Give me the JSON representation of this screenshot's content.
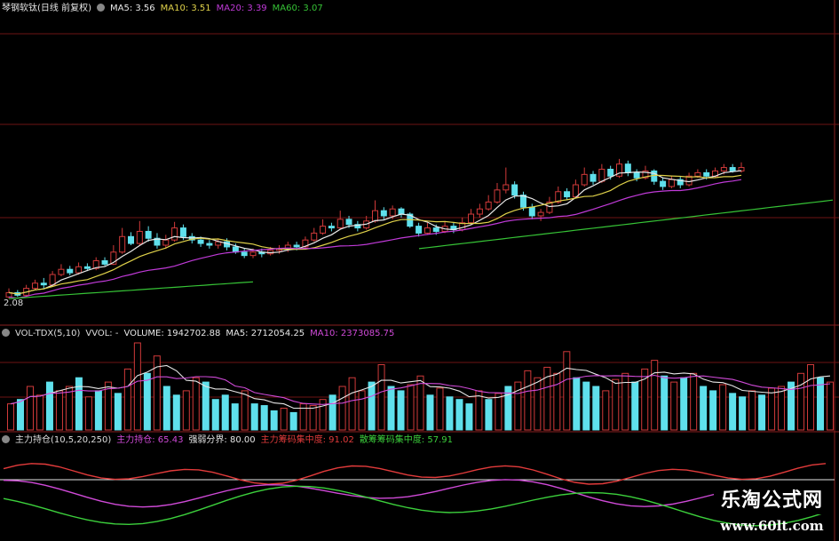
{
  "colors": {
    "background": "#000000",
    "frame": "#8a1f1f",
    "grid": "#6e1414",
    "up": "#d13a3a",
    "down": "#5fe0ec",
    "ma5": "#e8e8e8",
    "ma10": "#e0d24a",
    "ma20": "#c03ad8",
    "ma60": "#36c336",
    "main_force": "#e23b3b",
    "retail": "#3cd03c",
    "purple": "#d04ad8",
    "white_line": "#e6e6e6"
  },
  "main_panel": {
    "title": "琴钢软钛(日线 前复权)",
    "ma5_label": "MA5: 3.56",
    "ma10_label": "MA10: 3.51",
    "ma20_label": "MA20: 3.39",
    "ma60_label": "MA60: 3.07",
    "low_label": "2.08"
  },
  "volume_panel": {
    "name": "VOL-TDX(5,10)",
    "vvol": "VVOL: -",
    "volume": "VOLUME: 1942702.88",
    "ma5": "MA5: 2712054.25",
    "ma10": "MA10: 2373085.75"
  },
  "indicator_panel": {
    "name": "主力持仓(10,5,20,250)",
    "main": "主力持仓: 65.43",
    "strong": "强弱分界: 80.00",
    "main_chip": "主力筹码集中度: 91.02",
    "retail_chip": "散筹筹码集中度: 57.91"
  },
  "watermark": {
    "line1": "乐淘公式网",
    "line2": "www.60lt.com"
  },
  "chart_data": [
    {
      "type": "candlestick",
      "title": "琴钢软钛(日线 前复权)",
      "ylim": [
        2.0,
        4.1
      ],
      "low_marker": 2.08,
      "moving_averages": {
        "MA5": 3.56,
        "MA10": 3.51,
        "MA20": 3.39,
        "MA60": 3.07
      },
      "candles": [
        [
          2.1,
          2.15,
          2.2,
          2.08
        ],
        [
          2.15,
          2.12,
          2.18,
          2.1
        ],
        [
          2.12,
          2.2,
          2.24,
          2.1
        ],
        [
          2.2,
          2.26,
          2.3,
          2.18
        ],
        [
          2.26,
          2.24,
          2.32,
          2.2
        ],
        [
          2.24,
          2.36,
          2.4,
          2.22
        ],
        [
          2.36,
          2.42,
          2.48,
          2.34
        ],
        [
          2.42,
          2.38,
          2.46,
          2.35
        ],
        [
          2.38,
          2.45,
          2.5,
          2.36
        ],
        [
          2.45,
          2.43,
          2.49,
          2.4
        ],
        [
          2.43,
          2.52,
          2.56,
          2.41
        ],
        [
          2.52,
          2.48,
          2.56,
          2.46
        ],
        [
          2.48,
          2.62,
          2.7,
          2.47
        ],
        [
          2.62,
          2.8,
          2.9,
          2.6
        ],
        [
          2.8,
          2.72,
          2.85,
          2.7
        ],
        [
          2.72,
          2.86,
          2.98,
          2.7
        ],
        [
          2.86,
          2.78,
          2.92,
          2.74
        ],
        [
          2.78,
          2.7,
          2.84,
          2.66
        ],
        [
          2.7,
          2.76,
          2.82,
          2.66
        ],
        [
          2.76,
          2.9,
          2.97,
          2.74
        ],
        [
          2.9,
          2.8,
          2.94,
          2.76
        ],
        [
          2.8,
          2.76,
          2.84,
          2.72
        ],
        [
          2.76,
          2.72,
          2.8,
          2.68
        ],
        [
          2.72,
          2.7,
          2.76,
          2.66
        ],
        [
          2.7,
          2.74,
          2.78,
          2.66
        ],
        [
          2.74,
          2.68,
          2.78,
          2.64
        ],
        [
          2.68,
          2.62,
          2.72,
          2.6
        ],
        [
          2.62,
          2.58,
          2.66,
          2.55
        ],
        [
          2.58,
          2.62,
          2.66,
          2.55
        ],
        [
          2.62,
          2.6,
          2.66,
          2.56
        ],
        [
          2.6,
          2.64,
          2.68,
          2.58
        ],
        [
          2.64,
          2.66,
          2.7,
          2.6
        ],
        [
          2.66,
          2.7,
          2.74,
          2.62
        ],
        [
          2.7,
          2.68,
          2.74,
          2.64
        ],
        [
          2.68,
          2.76,
          2.8,
          2.66
        ],
        [
          2.76,
          2.84,
          2.9,
          2.74
        ],
        [
          2.84,
          2.92,
          3.0,
          2.82
        ],
        [
          2.92,
          2.9,
          2.96,
          2.86
        ],
        [
          2.9,
          3.0,
          3.1,
          2.88
        ],
        [
          3.0,
          2.94,
          3.04,
          2.9
        ],
        [
          2.94,
          2.9,
          2.98,
          2.86
        ],
        [
          2.9,
          2.98,
          3.04,
          2.88
        ],
        [
          2.98,
          3.1,
          3.22,
          2.96
        ],
        [
          3.1,
          3.04,
          3.14,
          3.0
        ],
        [
          3.04,
          3.12,
          3.16,
          3.0
        ],
        [
          3.12,
          3.06,
          3.14,
          3.02
        ],
        [
          3.06,
          2.92,
          3.08,
          2.9
        ],
        [
          2.92,
          2.84,
          2.96,
          2.8
        ],
        [
          2.84,
          2.9,
          2.96,
          2.82
        ],
        [
          2.9,
          2.86,
          2.94,
          2.82
        ],
        [
          2.86,
          2.92,
          2.98,
          2.84
        ],
        [
          2.92,
          2.88,
          2.96,
          2.84
        ],
        [
          2.88,
          2.96,
          3.02,
          2.86
        ],
        [
          2.96,
          3.06,
          3.12,
          2.94
        ],
        [
          3.06,
          3.12,
          3.18,
          3.02
        ],
        [
          3.12,
          3.2,
          3.28,
          3.1
        ],
        [
          3.2,
          3.34,
          3.42,
          3.18
        ],
        [
          3.34,
          3.4,
          3.6,
          3.3
        ],
        [
          3.4,
          3.28,
          3.44,
          3.24
        ],
        [
          3.28,
          3.14,
          3.32,
          3.1
        ],
        [
          3.14,
          3.04,
          3.18,
          3.0
        ],
        [
          3.04,
          3.08,
          3.12,
          2.98
        ],
        [
          3.08,
          3.2,
          3.26,
          3.06
        ],
        [
          3.2,
          3.32,
          3.38,
          3.18
        ],
        [
          3.32,
          3.26,
          3.36,
          3.22
        ],
        [
          3.26,
          3.4,
          3.46,
          3.24
        ],
        [
          3.4,
          3.52,
          3.6,
          3.38
        ],
        [
          3.52,
          3.44,
          3.56,
          3.4
        ],
        [
          3.44,
          3.58,
          3.64,
          3.42
        ],
        [
          3.58,
          3.5,
          3.62,
          3.46
        ],
        [
          3.5,
          3.64,
          3.7,
          3.48
        ],
        [
          3.64,
          3.54,
          3.68,
          3.5
        ],
        [
          3.54,
          3.48,
          3.58,
          3.44
        ],
        [
          3.48,
          3.56,
          3.62,
          3.46
        ],
        [
          3.56,
          3.44,
          3.58,
          3.4
        ],
        [
          3.44,
          3.38,
          3.48,
          3.34
        ],
        [
          3.38,
          3.46,
          3.5,
          3.36
        ],
        [
          3.46,
          3.4,
          3.5,
          3.36
        ],
        [
          3.4,
          3.5,
          3.54,
          3.38
        ],
        [
          3.5,
          3.54,
          3.58,
          3.48
        ],
        [
          3.54,
          3.5,
          3.58,
          3.46
        ],
        [
          3.5,
          3.56,
          3.6,
          3.48
        ],
        [
          3.56,
          3.6,
          3.64,
          3.52
        ],
        [
          3.6,
          3.56,
          3.64,
          3.54
        ],
        [
          3.56,
          3.6,
          3.66,
          3.54
        ]
      ]
    },
    {
      "type": "bar",
      "title": "VOL-TDX(5,10)",
      "volume": 1942702.88,
      "ma5": 2712054.25,
      "ma10": 2373085.75,
      "values_relative": [
        0.3,
        0.35,
        0.5,
        0.4,
        0.55,
        0.45,
        0.5,
        0.6,
        0.38,
        0.45,
        0.55,
        0.42,
        0.7,
        1.0,
        0.65,
        0.85,
        0.5,
        0.4,
        0.45,
        0.6,
        0.55,
        0.35,
        0.4,
        0.3,
        0.45,
        0.3,
        0.28,
        0.22,
        0.25,
        0.2,
        0.3,
        0.28,
        0.35,
        0.4,
        0.5,
        0.6,
        0.45,
        0.55,
        0.75,
        0.5,
        0.45,
        0.52,
        0.62,
        0.4,
        0.48,
        0.38,
        0.35,
        0.3,
        0.45,
        0.35,
        0.42,
        0.5,
        0.55,
        0.68,
        0.6,
        0.72,
        0.65,
        0.9,
        0.6,
        0.55,
        0.5,
        0.45,
        0.58,
        0.65,
        0.55,
        0.7,
        0.8,
        0.62,
        0.55,
        0.6,
        0.65,
        0.5,
        0.45,
        0.52,
        0.42,
        0.38,
        0.45,
        0.4,
        0.48,
        0.5,
        0.55,
        0.65,
        0.75,
        0.6,
        0.55
      ]
    },
    {
      "type": "line",
      "title": "主力持仓(10,5,20,250)",
      "ylim": [
        0,
        120
      ],
      "strong_weak_line": 80.0,
      "series": [
        {
          "name": "主力持仓",
          "last": 65.43
        },
        {
          "name": "主力筹码集中度",
          "last": 91.02
        },
        {
          "name": "散筹筹码集中度",
          "last": 57.91
        }
      ]
    }
  ]
}
